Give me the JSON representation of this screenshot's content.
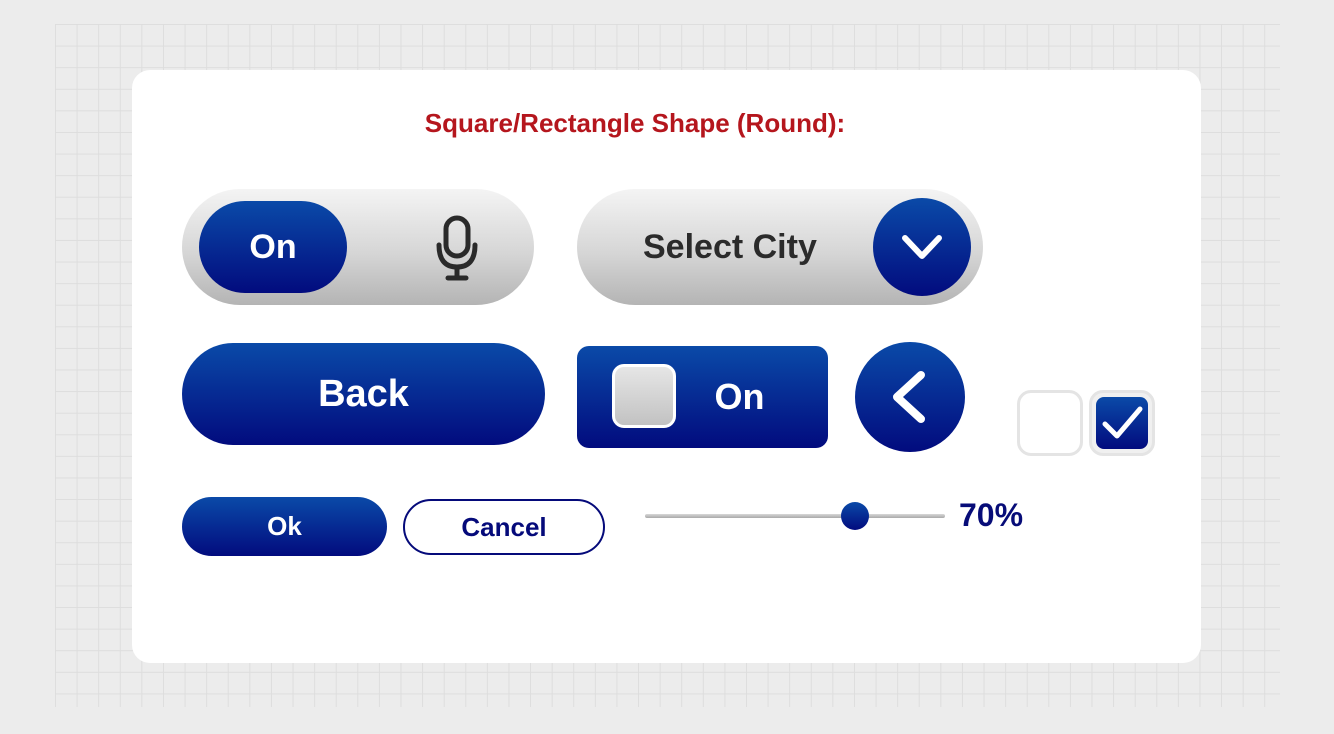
{
  "title": "Square/Rectangle Shape (Round):",
  "toggle_pill": {
    "label": "On",
    "icon": "microphone-icon"
  },
  "select": {
    "label": "Select City",
    "icon": "chevron-down-icon"
  },
  "back_button": {
    "label": "Back"
  },
  "square_toggle": {
    "label": "On",
    "state": "on"
  },
  "circle_back": {
    "icon": "chevron-left-icon"
  },
  "checkboxes": [
    {
      "checked": false
    },
    {
      "checked": true
    }
  ],
  "ok_button": {
    "label": "Ok"
  },
  "cancel_button": {
    "label": "Cancel"
  },
  "slider": {
    "value": 0.7,
    "label": "70%"
  },
  "colors": {
    "accent_top": "#0a4aa8",
    "accent_bottom": "#020b7e",
    "title_color": "#b5161d"
  }
}
